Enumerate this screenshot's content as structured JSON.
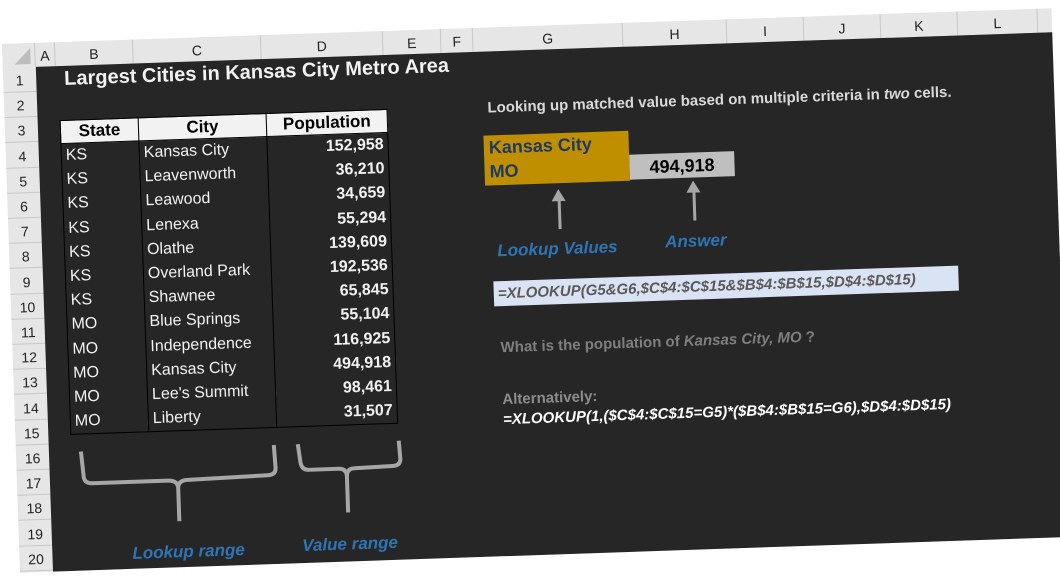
{
  "sheet": {
    "columns": [
      "A",
      "B",
      "C",
      "D",
      "E",
      "F",
      "G",
      "H",
      "I",
      "J",
      "K",
      "L"
    ],
    "rows": [
      "1",
      "2",
      "3",
      "4",
      "5",
      "6",
      "7",
      "8",
      "9",
      "10",
      "11",
      "12",
      "13",
      "14",
      "15",
      "16",
      "17",
      "18",
      "19",
      "20"
    ]
  },
  "title": "Largest Cities in Kansas City Metro Area",
  "table": {
    "headers": {
      "state": "State",
      "city": "City",
      "population": "Population"
    },
    "rows": [
      {
        "state": "KS",
        "city": "Kansas City",
        "population": "152,958"
      },
      {
        "state": "KS",
        "city": "Leavenworth",
        "population": "36,210"
      },
      {
        "state": "KS",
        "city": "Leawood",
        "population": "34,659"
      },
      {
        "state": "KS",
        "city": "Lenexa",
        "population": "55,294"
      },
      {
        "state": "KS",
        "city": "Olathe",
        "population": "139,609"
      },
      {
        "state": "KS",
        "city": "Overland Park",
        "population": "192,536"
      },
      {
        "state": "KS",
        "city": "Shawnee",
        "population": "65,845"
      },
      {
        "state": "MO",
        "city": "Blue Springs",
        "population": "55,104"
      },
      {
        "state": "MO",
        "city": "Independence",
        "population": "116,925"
      },
      {
        "state": "MO",
        "city": "Kansas City",
        "population": "494,918"
      },
      {
        "state": "MO",
        "city": "Lee's Summit",
        "population": "98,461"
      },
      {
        "state": "MO",
        "city": "Liberty",
        "population": "31,507"
      }
    ]
  },
  "description": {
    "pre": "Looking up matched value based on multiple criteria in ",
    "emph": "two",
    "post": "  cells."
  },
  "lookup_values": {
    "city": "Kansas City",
    "state": "MO"
  },
  "answer": "494,918",
  "labels": {
    "lookup_values": "Lookup Values",
    "answer": "Answer",
    "lookup_range": "Lookup range",
    "value_range": "Value range"
  },
  "formula_main": "=XLOOKUP(G5&G6,$C$4:$C$15&$B$4:$B$15,$D$4:$D$15)",
  "question": {
    "pre": "What is the population of ",
    "emph": "Kansas City, MO",
    "post": " ?"
  },
  "alternative": {
    "label": "Alternatively:",
    "formula": "=XLOOKUP(1,($C$4:$C$15=G5)*($B$4:$B$15=G6),$D$4:$D$15)"
  },
  "colors": {
    "background": "#262626",
    "lookup_fill": "#bf8f00",
    "lookup_text": "#1f3864",
    "answer_fill": "#bfbfbf",
    "label_blue": "#2e75b6",
    "formula_fill": "#dae3f3"
  }
}
